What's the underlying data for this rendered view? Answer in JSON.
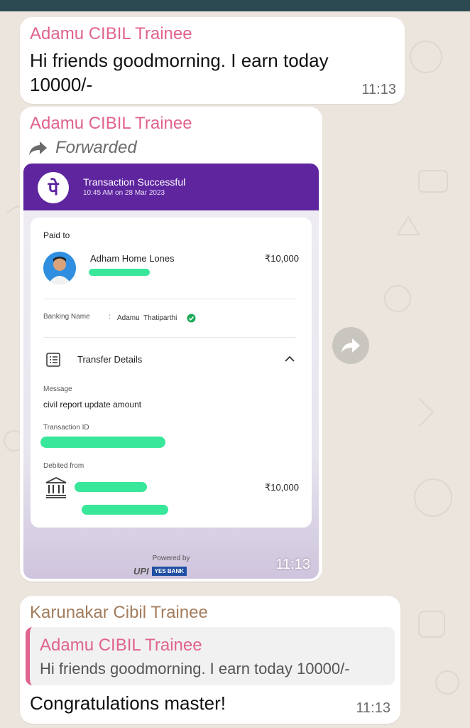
{
  "messages": [
    {
      "sender": "Adamu CIBIL Trainee",
      "text": "Hi friends goodmorning. I earn today 10000/-",
      "time": "11:13"
    },
    {
      "sender": "Adamu CIBIL Trainee",
      "forwarded_label": "Forwarded",
      "time": "11:13",
      "receipt": {
        "logo_glyph": "पे",
        "status_title": "Transaction Successful",
        "status_time": "10:45 AM on 28 Mar 2023",
        "paid_to_label": "Paid to",
        "payee_name": "Adham Home Lones",
        "amount": "₹10,000",
        "banking_name_label": "Banking Name",
        "banking_name_sep": ":",
        "banking_name_value": "Adamu  Thatiparthi",
        "transfer_details_label": "Transfer Details",
        "message_label": "Message",
        "message_value": "civil report update amount",
        "transaction_id_label": "Transaction ID",
        "debited_from_label": "Debited from",
        "debited_amount": "₹10,000",
        "powered_by": "Powered by",
        "upi_text": "UPI",
        "bank_text": "YES BANK"
      }
    },
    {
      "sender": "Karunakar Cibil Trainee",
      "quoted_sender": "Adamu CIBIL Trainee",
      "quoted_text": "Hi friends goodmorning. I earn today 10000/-",
      "text": "Congratulations master!",
      "time": "11:13"
    }
  ],
  "colors": {
    "sender_pink": "#e0628f",
    "sender_brown": "#a37c5c",
    "phonepe_purple": "#5f259f",
    "redaction_green": "#39e79a",
    "chat_background": "#ece5dd"
  },
  "icons": {
    "forward": "forward-arrow-icon",
    "share": "share-icon",
    "verified": "verified-check-icon",
    "details": "list-icon",
    "collapse": "chevron-up-icon",
    "bank": "bank-icon"
  }
}
